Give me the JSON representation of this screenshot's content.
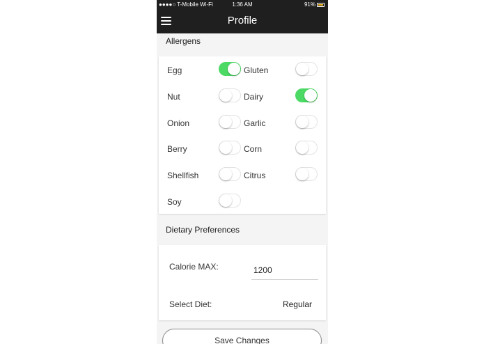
{
  "status_bar": {
    "carrier": "●●●●○ T-Mobile Wi-Fi",
    "time": "1:36 AM",
    "battery": "91%"
  },
  "nav": {
    "title": "Profile",
    "menu_icon": "hamburger-menu-icon"
  },
  "allergens": {
    "title": "Allergens",
    "items": [
      {
        "label": "Egg",
        "on": true
      },
      {
        "label": "Gluten",
        "on": false
      },
      {
        "label": "Nut",
        "on": false
      },
      {
        "label": "Dairy",
        "on": true
      },
      {
        "label": "Onion",
        "on": false
      },
      {
        "label": "Garlic",
        "on": false
      },
      {
        "label": "Berry",
        "on": false
      },
      {
        "label": "Corn",
        "on": false
      },
      {
        "label": "Shellfish",
        "on": false
      },
      {
        "label": "Citrus",
        "on": false
      },
      {
        "label": "Soy",
        "on": false
      }
    ]
  },
  "dietary": {
    "title": "Dietary Preferences",
    "calorie_label": "Calorie MAX:",
    "calorie_value": "1200",
    "diet_label": "Select Diet:",
    "diet_value": "Regular"
  },
  "actions": {
    "save_label": "Save Changes"
  },
  "colors": {
    "toggle_on": "#4cd964",
    "nav_bg": "#1f1f1f",
    "battery": "#f5b81f"
  }
}
